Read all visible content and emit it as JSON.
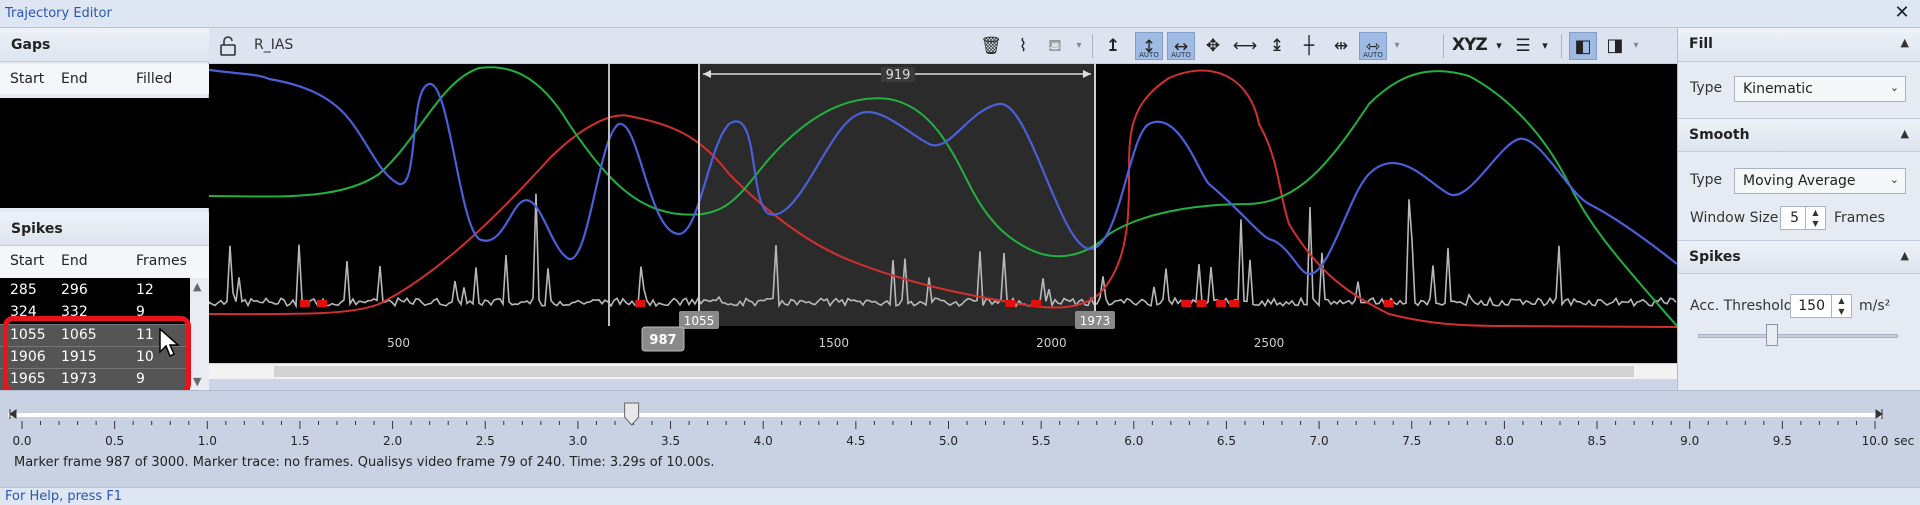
{
  "window": {
    "title": "Trajectory Editor",
    "close_glyph": "✕"
  },
  "gaps": {
    "title": "Gaps",
    "columns": [
      "Start",
      "End",
      "Filled"
    ]
  },
  "spikes": {
    "title": "Spikes",
    "columns": [
      "Start",
      "End",
      "Frames"
    ],
    "rows": [
      {
        "start": "285",
        "end": "296",
        "frames": "12",
        "selected": false
      },
      {
        "start": "324",
        "end": "332",
        "frames": "9",
        "selected": false
      },
      {
        "start": "1055",
        "end": "1065",
        "frames": "11",
        "selected": true
      },
      {
        "start": "1906",
        "end": "1915",
        "frames": "10",
        "selected": true
      },
      {
        "start": "1965",
        "end": "1973",
        "frames": "9",
        "selected": true
      }
    ]
  },
  "toolbar": {
    "trace_name": "R_IAS",
    "xyz_label": "XYZ",
    "auto_label": "AUTO",
    "icons": [
      "lock-icon",
      "trash-icon",
      "fill-icon",
      "paint-bucket-icon",
      "y-axis-icon",
      "auto-scale-y-icon",
      "auto-scale-x-icon",
      "move-icon",
      "zoom-x-icon",
      "zoom-y-icon",
      "crosshair-icon",
      "range-icon",
      "auto-range-icon",
      "legend-list-icon",
      "panel-left-icon",
      "panel-right-icon"
    ]
  },
  "plot": {
    "selection_width_label": "919",
    "selection_start_label": "1055",
    "selection_end_label": "1973",
    "current_frame_label": "987",
    "x_ticks": [
      {
        "value": 500,
        "label": "500"
      },
      {
        "value": 1500,
        "label": "1500"
      },
      {
        "value": 2000,
        "label": "2000"
      },
      {
        "value": 2500,
        "label": "2500"
      }
    ],
    "spike_markers": [
      285,
      324,
      1055,
      1906,
      1965,
      2310,
      2345,
      2390,
      2420,
      2775
    ],
    "colors": {
      "x": "#d03030",
      "y": "#22b040",
      "z": "#4a5fd8",
      "speed": "#b8b8b8",
      "marker": "#e01010"
    }
  },
  "fill": {
    "title": "Fill",
    "type_label": "Type",
    "type_value": "Kinematic"
  },
  "smooth": {
    "title": "Smooth",
    "type_label": "Type",
    "type_value": "Moving Average",
    "window_label": "Window Size",
    "window_value": "5",
    "window_unit": "Frames"
  },
  "spike_settings": {
    "title": "Spikes",
    "threshold_label": "Acc. Threshold",
    "threshold_value": "150",
    "threshold_unit": "m/s²"
  },
  "timeline": {
    "ticks": [
      "0.0",
      "0.5",
      "1.0",
      "1.5",
      "2.0",
      "2.5",
      "3.0",
      "3.5",
      "4.0",
      "4.5",
      "5.0",
      "5.5",
      "6.0",
      "6.5",
      "7.0",
      "7.5",
      "8.0",
      "8.5",
      "9.0",
      "9.5",
      "10.0"
    ],
    "unit": "sec",
    "position_sec": 3.29,
    "status": "Marker frame 987 of 3000. Marker trace: no frames. Qualisys video frame 79 of 240. Time: 3.29s of 10.00s."
  },
  "help": {
    "text": "For Help, press F1"
  }
}
